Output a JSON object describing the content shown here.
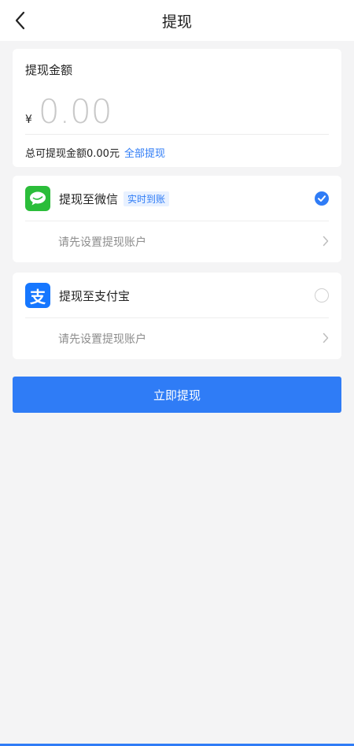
{
  "header": {
    "title": "提现",
    "back_icon": "chevron-left-icon"
  },
  "amount": {
    "title": "提现金额",
    "currency": "¥",
    "placeholder": "0.00",
    "available_label": "总可提现金额0.00元",
    "withdraw_all_label": "全部提现"
  },
  "methods": [
    {
      "label": "提现至微信",
      "tag": "实时到账",
      "icon": "wechat-logo-icon",
      "selected": true,
      "setup_label": "请先设置提现账户"
    },
    {
      "label": "提现至支付宝",
      "icon": "alipay-logo-icon",
      "logo_glyph": "支",
      "selected": false,
      "setup_label": "请先设置提现账户"
    }
  ],
  "submit_label": "立即提现",
  "colors": {
    "accent": "#2f7cf6",
    "wechat": "#2bbd3a",
    "alipay": "#1677ff",
    "background": "#f4f4f5"
  }
}
